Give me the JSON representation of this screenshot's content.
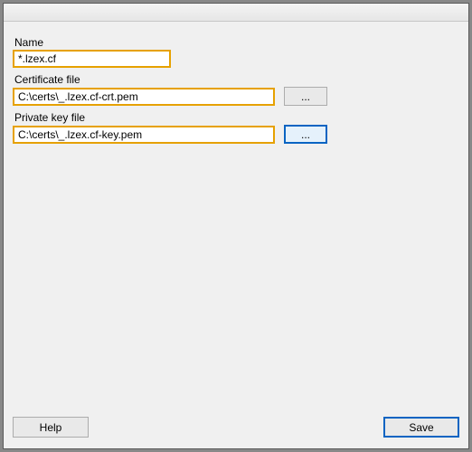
{
  "titlebar": {
    "title": ""
  },
  "form": {
    "name": {
      "label": "Name",
      "value": "*.lzex.cf"
    },
    "certfile": {
      "label": "Certificate file",
      "value": "C:\\certs\\_.lzex.cf-crt.pem",
      "browse": "..."
    },
    "keyfile": {
      "label": "Private key file",
      "value": "C:\\certs\\_.lzex.cf-key.pem",
      "browse": "..."
    }
  },
  "footer": {
    "help": "Help",
    "save": "Save"
  }
}
